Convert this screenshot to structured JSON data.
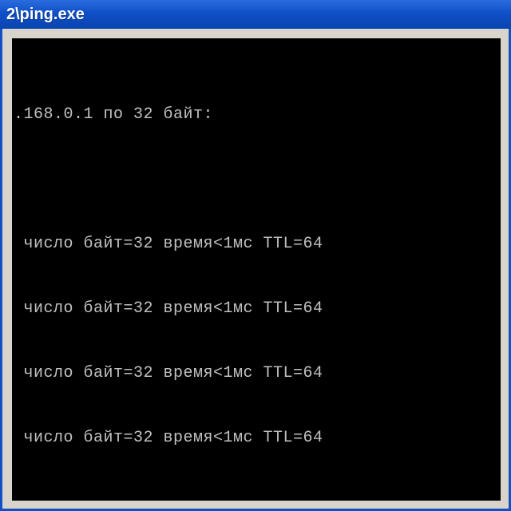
{
  "titlebar": {
    "title": "2\\ping.exe"
  },
  "console": {
    "header": ".168.0.1 по 32 байт:",
    "replies": [
      " число байт=32 время<1мс TTL=64",
      " число байт=32 время<1мс TTL=64",
      " число байт=32 время<1мс TTL=64",
      " число байт=32 время<1мс TTL=64"
    ]
  }
}
